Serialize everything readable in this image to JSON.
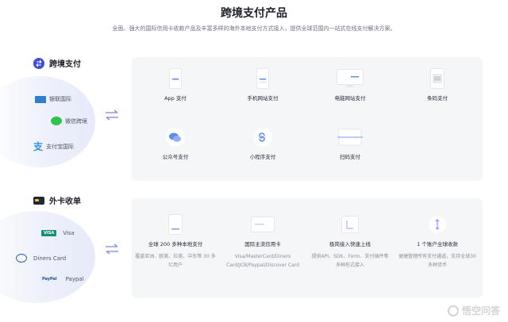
{
  "page": {
    "title": "跨境支付产品",
    "subtitle": "全面、强大的国际信用卡收款产品及丰富多样的海外本地支付方式接入，提供全球范围内一站式在线支付解决方案。"
  },
  "section1": {
    "title": "跨境支付",
    "icon": "exchange-icon",
    "brands": [
      {
        "label": "银联国际",
        "icon": "unionpay-icon"
      },
      {
        "label": "微信跨境",
        "icon": "wechat-icon"
      },
      {
        "label": "支付宝国际",
        "icon": "alipay-icon"
      }
    ],
    "items": [
      {
        "label": "App 支付",
        "icon": "app-phone-icon"
      },
      {
        "label": "手机网站支付",
        "icon": "mobile-web-icon"
      },
      {
        "label": "电脑网站支付",
        "icon": "desktop-web-icon"
      },
      {
        "label": "条码支付",
        "icon": "barcode-scanner-icon"
      },
      {
        "label": "公众号支付",
        "icon": "wechat-official-icon"
      },
      {
        "label": "小程序支付",
        "icon": "mini-program-icon"
      },
      {
        "label": "扫码支付",
        "icon": "scan-code-icon"
      }
    ]
  },
  "section2": {
    "title": "外卡收单",
    "icon": "card-icon",
    "brands": [
      {
        "label": "Visa",
        "icon": "visa-icon",
        "badge": "VISA"
      },
      {
        "label": "Diners Card",
        "icon": "diners-icon"
      },
      {
        "label": "Paypal",
        "icon": "paypal-icon",
        "badge": "PayPal"
      }
    ],
    "items": [
      {
        "label": "全球 200 多种本地支付",
        "desc": "覆盖亚洲、欧美、拉美、中东等 30 多亿用户",
        "icon": "local-pay-icon"
      },
      {
        "label": "国际主流信用卡",
        "desc": "Visa/MasterCard/Diners Card/JCB/Paypal/Discover Card",
        "icon": "credit-card-icon"
      },
      {
        "label": "极简接入快速上线",
        "desc": "提供API、SDK、Form、支付插件等多种形式接入",
        "icon": "integration-icon"
      },
      {
        "label": "1 个账户全球收款",
        "desc": "便捷管理所有支付通道，支持全球30多种货币",
        "icon": "global-account-icon"
      }
    ]
  },
  "watermark": "悟空问答"
}
